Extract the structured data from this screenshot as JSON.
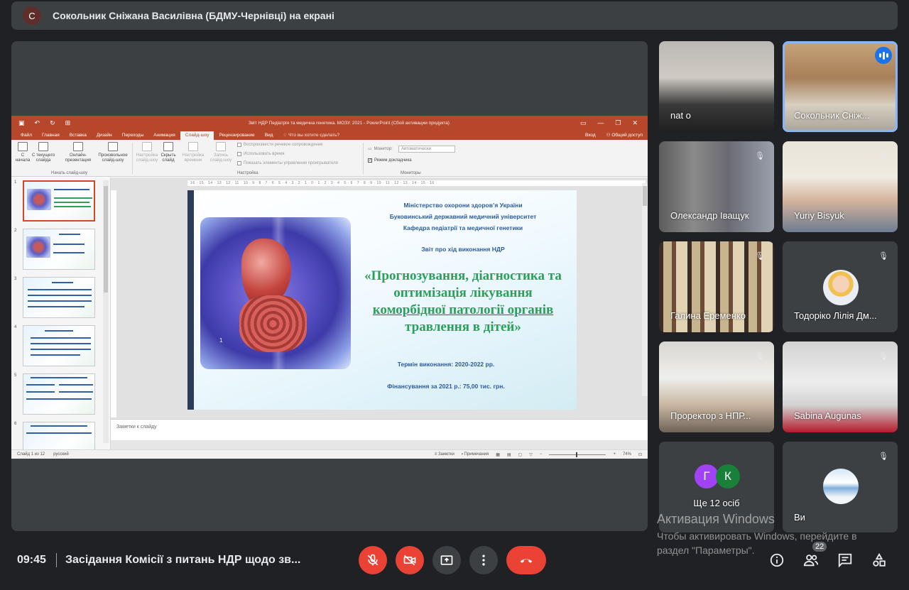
{
  "presenter_bar": {
    "avatar_letter": "С",
    "title": "Сокольник Сніжана Василівна (БДМУ-Чернівці) на екрані"
  },
  "ppt": {
    "window_title": "Звіт НДР Педіатрія та медична генетика. МОЗУ. 2021 - PowerPoint (Сбой активации продукта)",
    "tabs": [
      "Файл",
      "Главная",
      "Вставка",
      "Дизайн",
      "Переходы",
      "Анимация",
      "Слайд-шоу",
      "Рецензирование",
      "Вид"
    ],
    "active_tab": "Слайд-шоу",
    "tell_me": "Что вы хотите сделать?",
    "sign_in": "Вход",
    "share": "Общий доступ",
    "ribbon": {
      "from_start": "С\nначала",
      "from_current": "С текущего\nслайда",
      "online": "Онлайн-\nпрезентация",
      "custom": "Произвольное\nслайд-шоу",
      "group_start": "Начать слайд-шоу",
      "setup": "Настройка\nслайд-шоу",
      "hide": "Скрыть\nслайд",
      "rehearse": "Настройка\nвремени",
      "record": "Запись\nслайд-шоу",
      "chk_narration": "Воспроизвести речевое сопровождение",
      "chk_timings": "Использовать время",
      "chk_controls": "Показать элементы управления проигрывателя",
      "group_setup": "Настройка",
      "monitor_label": "Монитор:",
      "monitor_value": "Автоматически",
      "presenter_view": "Режим докладчика",
      "group_monitors": "Мониторы"
    },
    "slide_numbers": [
      "1",
      "2",
      "3",
      "4",
      "5",
      "6"
    ],
    "slide": {
      "line1": "Міністерство охорони здоров’я України",
      "line2": "Буковинський державний медичний університет",
      "line3": "Кафедра педіатрії та медичної генетики",
      "report": "Звіт про хід виконання  НДР",
      "title1": "«Прогнозування, діагностика та",
      "title2": "оптимізація лікування",
      "title3": "коморбідної патології органів",
      "title4": "травлення в дітей»",
      "term": "Термін виконання: 2020-2022 рр.",
      "funding": "Фінансування за 2021 р.: 75,00 тис. грн.",
      "num": "1"
    },
    "notes_placeholder": "Заметки к слайду",
    "status": {
      "slide_count": "Слайд 1 из 12",
      "language": "русский",
      "notes": "Заметки",
      "comments": "Примечания",
      "zoom": "74%"
    }
  },
  "participants": [
    {
      "name": "nat o",
      "muted": false
    },
    {
      "name": "Сокольник Сніж...",
      "speaking": true
    },
    {
      "name": "Олександр Іващук",
      "muted": true
    },
    {
      "name": "Yuriy Bisyuk",
      "muted": true
    },
    {
      "name": "Галина Еременко",
      "muted": true
    },
    {
      "name": "Тодоріко Лілія Дм...",
      "muted": true
    },
    {
      "name": "Проректор з НПР...",
      "muted": true
    },
    {
      "name": "Sabina Augunas",
      "muted": true
    },
    {
      "name": "Ще 12 осіб",
      "avatars": [
        "Г",
        "К"
      ]
    },
    {
      "name": "Ви",
      "muted": true
    }
  ],
  "watermark": {
    "line1": "Активация Windows",
    "line2": "Чтобы активировать Windows, перейдите в раздел \"Параметры\"."
  },
  "bottom": {
    "time": "09:45",
    "meeting": "Засідання Комісії з питань НДР щодо зв...",
    "people_count": "22"
  },
  "icons": {
    "mic_off": "mic-off-icon",
    "cam_off": "camera-off-icon",
    "present": "present-screen-icon",
    "more": "more-vert-icon",
    "hangup": "hang-up-icon",
    "info": "info-icon",
    "people": "people-icon",
    "chat": "chat-icon",
    "activities": "activities-icon"
  },
  "colors": {
    "meet_bg": "#202124",
    "tile_bg": "#3c4043",
    "ppt_accent": "#b7472a",
    "danger": "#ea4335",
    "speaker_outline": "#8ab4f8"
  }
}
